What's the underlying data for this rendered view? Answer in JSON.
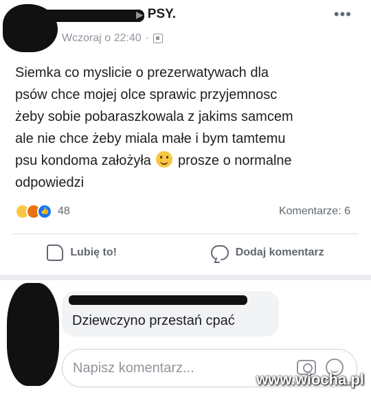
{
  "post": {
    "group_name": "PSY.",
    "arrow_glyph": "▶",
    "timestamp": "Wczoraj o 22:40",
    "separator": "·",
    "more_glyph": "•••",
    "text_before_emoji": "Siemka co myslicie o prezerwatywach dla\npsów chce mojej olce sprawic przyjemnosc\nżeby sobie pobaraszkowala z jakims samcem\nale nie chce żeby miala małe i bym tamtemu\npsu kondoma założyła ",
    "text_after_emoji": " prosze o normalne\nodpowiedzi",
    "emoji_icon": "smile-emoji-icon",
    "reaction_count": "48",
    "comments_label": "Komentarze: 6",
    "like_label": "Lubię to!",
    "comment_label": "Dodaj komentarz"
  },
  "comment": {
    "text": "Dziewczyno przestań cpać"
  },
  "reply": {
    "placeholder": "Napisz komentarz..."
  },
  "watermark": "www.wiocha.pl",
  "colors": {
    "text": "#1c1e21",
    "muted": "#606770",
    "meta": "#90949c",
    "like_blue": "#1877f2",
    "bubble": "#f2f3f5"
  }
}
